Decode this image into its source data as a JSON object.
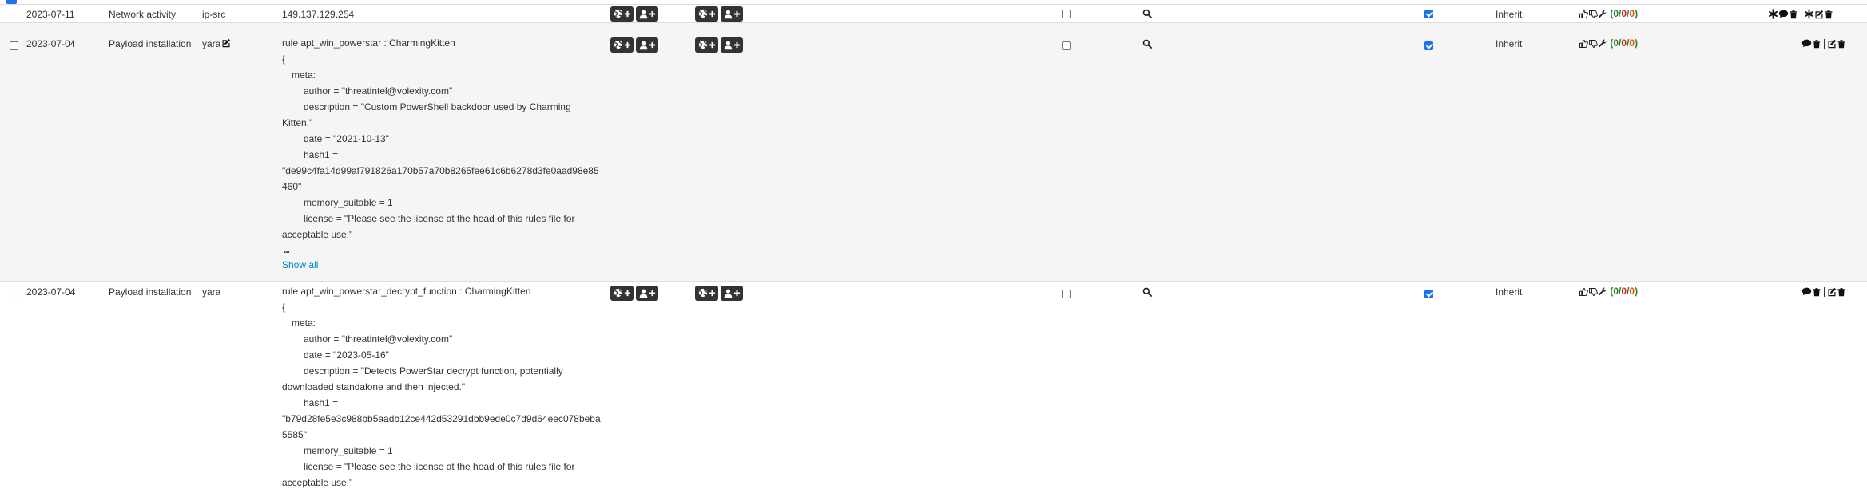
{
  "rows": [
    {
      "date": "2023-07-11",
      "category": "Network activity",
      "type": "ip-src",
      "value": "149.137.129.254",
      "distribution": "Inherit",
      "sightings": {
        "open": "(",
        "a": "0",
        "s1": "/",
        "b": "0",
        "s2": "/",
        "c": "0",
        "close": ")"
      }
    },
    {
      "date": "2023-07-04",
      "category": "Payload installation",
      "type": "yara",
      "value_lines": [
        {
          "text": "rule apt_win_powerstar : CharmingKitten",
          "indent": 0
        },
        {
          "text": "{",
          "indent": 0
        },
        {
          "text": "meta:",
          "indent": 1
        },
        {
          "text": "author = \"threatintel@volexity.com\"",
          "indent": 2
        },
        {
          "text": "description = \"Custom PowerShell backdoor used by Charming",
          "indent": 2
        },
        {
          "text": "Kitten.\"",
          "indent": 0
        },
        {
          "text": "date = \"2021-10-13\"",
          "indent": 2
        },
        {
          "text": "hash1 =",
          "indent": 2
        },
        {
          "text": "\"de99c4fa14d99af791826a170b57a70b8265fee61c6b6278d3fe0aad98e85",
          "indent": 0
        },
        {
          "text": "460\"",
          "indent": 0
        },
        {
          "text": "memory_suitable = 1",
          "indent": 2
        },
        {
          "text": "license = \"Please see the license at the head of this rules file for",
          "indent": 2
        },
        {
          "text": "acceptable use.\"",
          "indent": 0
        }
      ],
      "ellipsis": "...",
      "show_all": "Show all",
      "distribution": "Inherit",
      "sightings": {
        "open": "(",
        "a": "0",
        "s1": "/",
        "b": "0",
        "s2": "/",
        "c": "0",
        "close": ")"
      }
    },
    {
      "date": "2023-07-04",
      "category": "Payload installation",
      "type": "yara",
      "value_lines": [
        {
          "text": "rule apt_win_powerstar_decrypt_function : CharmingKitten",
          "indent": 0
        },
        {
          "text": "{",
          "indent": 0
        },
        {
          "text": "meta:",
          "indent": 1
        },
        {
          "text": "author = \"threatintel@volexity.com\"",
          "indent": 2
        },
        {
          "text": "date = \"2023-05-16\"",
          "indent": 2
        },
        {
          "text": "description = \"Detects PowerStar decrypt function, potentially",
          "indent": 2
        },
        {
          "text": "downloaded standalone and then injected.\"",
          "indent": 0
        },
        {
          "text": "hash1 =",
          "indent": 2
        },
        {
          "text": "\"b79d28fe5e3c988bb5aadb12ce442d53291dbb9ede0c7d9d64eec078beba",
          "indent": 0
        },
        {
          "text": "5585\"",
          "indent": 0
        },
        {
          "text": "memory_suitable = 1",
          "indent": 2
        },
        {
          "text": "license = \"Please see the license at the head of this rules file for",
          "indent": 2
        },
        {
          "text": "acceptable use.\"",
          "indent": 0
        }
      ],
      "distribution": "Inherit",
      "sightings": {
        "open": "(",
        "a": "0",
        "s1": "/",
        "b": "0",
        "s2": "/",
        "c": "0",
        "close": ")"
      }
    }
  ],
  "colors": {
    "stripe": "#f5f5f5",
    "badge": "#333333",
    "link": "#0088cc",
    "checkbox_checked": "#1a73e8",
    "sightings_green": "#2e7d32",
    "sightings_red": "#c62828",
    "sightings_orange": "#e65100"
  },
  "icons": [
    "globe-plus-icon",
    "user-plus-icon",
    "search-icon",
    "thumbs-up-icon",
    "thumbs-down-icon",
    "wrench-icon",
    "asterisk-icon",
    "comment-icon",
    "trash-icon",
    "edit-icon"
  ]
}
